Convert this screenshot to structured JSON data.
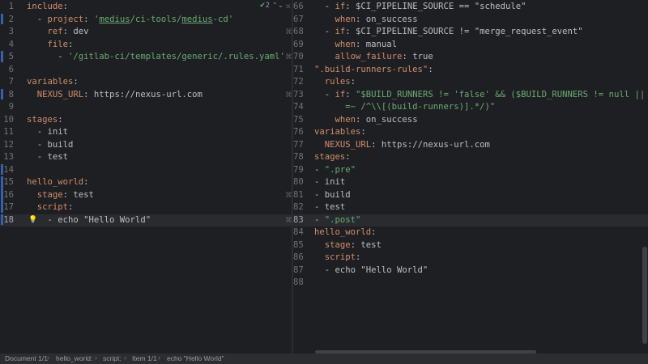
{
  "left_editor": {
    "lines": [
      {
        "num": "1",
        "tokens": [
          {
            "t": "include",
            "c": "k"
          },
          {
            "t": ":",
            "c": "p"
          }
        ]
      },
      {
        "num": "2",
        "tokens": [
          {
            "t": "  - ",
            "c": "dash"
          },
          {
            "t": "project",
            "c": "k"
          },
          {
            "t": ": ",
            "c": "p"
          },
          {
            "t": "'",
            "c": "s"
          },
          {
            "t": "medius",
            "c": "s ul"
          },
          {
            "t": "/ci-tools/",
            "c": "s"
          },
          {
            "t": "medius",
            "c": "s ul"
          },
          {
            "t": "-cd'",
            "c": "s"
          }
        ]
      },
      {
        "num": "3",
        "tokens": [
          {
            "t": "    ",
            "c": "p"
          },
          {
            "t": "ref",
            "c": "k"
          },
          {
            "t": ": dev",
            "c": "p"
          }
        ]
      },
      {
        "num": "4",
        "tokens": [
          {
            "t": "    ",
            "c": "p"
          },
          {
            "t": "file",
            "c": "k"
          },
          {
            "t": ":",
            "c": "p"
          }
        ]
      },
      {
        "num": "5",
        "tokens": [
          {
            "t": "      - ",
            "c": "dash"
          },
          {
            "t": "'/gitlab-ci/templates/generic/.rules.yaml'",
            "c": "s"
          }
        ]
      },
      {
        "num": "6",
        "tokens": []
      },
      {
        "num": "7",
        "tokens": [
          {
            "t": "variables",
            "c": "k"
          },
          {
            "t": ":",
            "c": "p"
          }
        ]
      },
      {
        "num": "8",
        "tokens": [
          {
            "t": "  ",
            "c": "p"
          },
          {
            "t": "NEXUS_URL",
            "c": "k"
          },
          {
            "t": ": https://nexus-url.com",
            "c": "p"
          }
        ]
      },
      {
        "num": "9",
        "tokens": []
      },
      {
        "num": "10",
        "tokens": [
          {
            "t": "stages",
            "c": "k"
          },
          {
            "t": ":",
            "c": "p"
          }
        ]
      },
      {
        "num": "11",
        "tokens": [
          {
            "t": "  - init",
            "c": "p"
          }
        ]
      },
      {
        "num": "12",
        "tokens": [
          {
            "t": "  - build",
            "c": "p"
          }
        ]
      },
      {
        "num": "13",
        "tokens": [
          {
            "t": "  - test",
            "c": "p"
          }
        ]
      },
      {
        "num": "14",
        "tokens": []
      },
      {
        "num": "15",
        "tokens": [
          {
            "t": "hello_world",
            "c": "k"
          },
          {
            "t": ":",
            "c": "p"
          }
        ]
      },
      {
        "num": "16",
        "tokens": [
          {
            "t": "  ",
            "c": "p"
          },
          {
            "t": "stage",
            "c": "k"
          },
          {
            "t": ": test",
            "c": "p"
          }
        ]
      },
      {
        "num": "17",
        "tokens": [
          {
            "t": "  ",
            "c": "p"
          },
          {
            "t": "script",
            "c": "k"
          },
          {
            "t": ":",
            "c": "p"
          }
        ]
      },
      {
        "num": "18",
        "tokens": [
          {
            "t": "    - echo \"Hello World\"",
            "c": "p"
          }
        ]
      }
    ],
    "inline_marks": [
      {
        "line": 0,
        "text": "✕"
      },
      {
        "line": 2,
        "text": "⌘"
      },
      {
        "line": 4,
        "text": "⌘"
      },
      {
        "line": 7,
        "text": "⌘"
      },
      {
        "line": 15,
        "text": "⌘"
      },
      {
        "line": 17,
        "text": "⌘"
      }
    ],
    "warning_count": "2"
  },
  "right_editor": {
    "lines": [
      {
        "num": "66",
        "tokens": [
          {
            "t": "  - ",
            "c": "dash"
          },
          {
            "t": "if",
            "c": "k"
          },
          {
            "t": ": $CI_PIPELINE_SOURCE == \"schedule\"",
            "c": "p"
          }
        ]
      },
      {
        "num": "67",
        "tokens": [
          {
            "t": "    ",
            "c": "p"
          },
          {
            "t": "when",
            "c": "k"
          },
          {
            "t": ": on_success",
            "c": "p"
          }
        ]
      },
      {
        "num": "68",
        "tokens": [
          {
            "t": "  - ",
            "c": "dash"
          },
          {
            "t": "if",
            "c": "k"
          },
          {
            "t": ": $CI_PIPELINE_SOURCE != \"merge_request_event\"",
            "c": "p"
          }
        ]
      },
      {
        "num": "69",
        "tokens": [
          {
            "t": "    ",
            "c": "p"
          },
          {
            "t": "when",
            "c": "k"
          },
          {
            "t": ": manual",
            "c": "p"
          }
        ]
      },
      {
        "num": "70",
        "tokens": [
          {
            "t": "    ",
            "c": "p"
          },
          {
            "t": "allow_failure",
            "c": "k"
          },
          {
            "t": ": true",
            "c": "p"
          }
        ]
      },
      {
        "num": "71",
        "tokens": [
          {
            "t": "\".build-runners-rules\"",
            "c": "k"
          },
          {
            "t": ":",
            "c": "p"
          }
        ]
      },
      {
        "num": "72",
        "tokens": [
          {
            "t": "  ",
            "c": "p"
          },
          {
            "t": "rules",
            "c": "k"
          },
          {
            "t": ":",
            "c": "p"
          }
        ]
      },
      {
        "num": "73",
        "tokens": [
          {
            "t": "  - ",
            "c": "dash"
          },
          {
            "t": "if",
            "c": "k"
          },
          {
            "t": ": ",
            "c": "p"
          },
          {
            "t": "\"$BUILD_RUNNERS != 'false' && ($BUILD_RUNNERS != null || $CI_COMM",
            "c": "s"
          }
        ]
      },
      {
        "num": "74",
        "tokens": [
          {
            "t": "      =~ /^\\\\[(build-runners)].*/)\"",
            "c": "s"
          }
        ]
      },
      {
        "num": "75",
        "tokens": [
          {
            "t": "    ",
            "c": "p"
          },
          {
            "t": "when",
            "c": "k"
          },
          {
            "t": ": on_success",
            "c": "p"
          }
        ]
      },
      {
        "num": "76",
        "tokens": [
          {
            "t": "variables",
            "c": "k"
          },
          {
            "t": ":",
            "c": "p"
          }
        ]
      },
      {
        "num": "77",
        "tokens": [
          {
            "t": "  ",
            "c": "p"
          },
          {
            "t": "NEXUS_URL",
            "c": "k"
          },
          {
            "t": ": https://nexus-url.com",
            "c": "p"
          }
        ]
      },
      {
        "num": "78",
        "tokens": [
          {
            "t": "stages",
            "c": "k"
          },
          {
            "t": ":",
            "c": "p"
          }
        ]
      },
      {
        "num": "79",
        "tokens": [
          {
            "t": "- ",
            "c": "dash"
          },
          {
            "t": "\".pre\"",
            "c": "s"
          }
        ]
      },
      {
        "num": "80",
        "tokens": [
          {
            "t": "- init",
            "c": "p"
          }
        ]
      },
      {
        "num": "81",
        "tokens": [
          {
            "t": "- build",
            "c": "p"
          }
        ]
      },
      {
        "num": "82",
        "tokens": [
          {
            "t": "- test",
            "c": "p"
          }
        ]
      },
      {
        "num": "83",
        "tokens": [
          {
            "t": "- ",
            "c": "dash"
          },
          {
            "t": "\".post\"",
            "c": "s"
          }
        ]
      },
      {
        "num": "84",
        "tokens": [
          {
            "t": "hello_world",
            "c": "k"
          },
          {
            "t": ":",
            "c": "p"
          }
        ]
      },
      {
        "num": "85",
        "tokens": [
          {
            "t": "  ",
            "c": "p"
          },
          {
            "t": "stage",
            "c": "k"
          },
          {
            "t": ": test",
            "c": "p"
          }
        ]
      },
      {
        "num": "86",
        "tokens": [
          {
            "t": "  ",
            "c": "p"
          },
          {
            "t": "script",
            "c": "k"
          },
          {
            "t": ":",
            "c": "p"
          }
        ]
      },
      {
        "num": "87",
        "tokens": [
          {
            "t": "  - echo \"Hello World\"",
            "c": "p"
          }
        ]
      },
      {
        "num": "88",
        "tokens": []
      }
    ]
  },
  "status_bar": {
    "breadcrumbs": [
      "Document 1/1",
      "hello_world:",
      "script:",
      "Item 1/1",
      "echo \"Hello World\""
    ]
  },
  "colors": {
    "background": "#1e1f22",
    "keyword": "#cf8e6d",
    "string": "#6aab73",
    "plain": "#bcbec4",
    "change_marker": "#375fad",
    "status_bar": "#2b2d30"
  }
}
